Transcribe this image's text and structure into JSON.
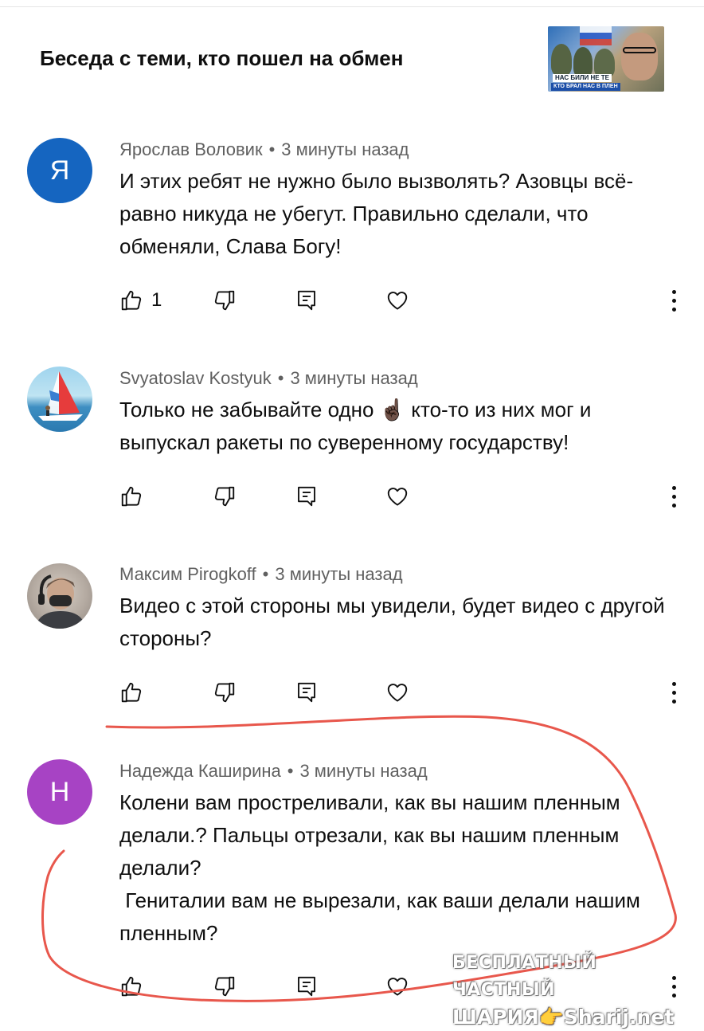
{
  "header": {
    "title": "Беседа с теми, кто пошел на обмен",
    "thumbnail_caption_1": "НАС БИЛИ НЕ ТЕ",
    "thumbnail_caption_2": "КТО БРАЛ НАС В ПЛЕН"
  },
  "comments": [
    {
      "author": "Ярослав Воловик",
      "time": "3 минуты назад",
      "avatar_letter": "Я",
      "avatar_color": "#1565c0",
      "text": "И этих ребят не нужно было вызволять? Азовцы всё-равно никуда не убегут. Правильно сделали, что обменяли, Слава Богу!",
      "likes": "1"
    },
    {
      "author": "Svyatoslav Kostyuk",
      "time": "3 минуты назад",
      "avatar_letter": "",
      "avatar_color": "#7fc1e0",
      "text": "Только не забывайте одно ☝🏿 кто-то из них мог и выпускал ракеты по суверенному государству!",
      "likes": ""
    },
    {
      "author": "Максим Pirogkoff",
      "time": "3 минуты назад",
      "avatar_letter": "",
      "avatar_color": "#b9b3ad",
      "text": "Видео с этой стороны мы увидели, будет видео с другой стороны?",
      "likes": ""
    },
    {
      "author": "Надежда Каширина",
      "time": "3 минуты назад",
      "avatar_letter": "Н",
      "avatar_color": "#a743c4",
      "text": "Колени вам простреливали, как вы нашим пленным делали.? Пальцы отрезали, как вы нашим пленным делали?\n Гениталии вам не вырезали, как ваши делали нашим пленным?",
      "likes": ""
    }
  ],
  "meta_separator": "•",
  "watermark": {
    "line1": "БЕСПЛАТНЫЙ ЧАСТНЫЙ",
    "line2": "ШАРИЯ👉Sharij.net"
  },
  "colors": {
    "text_primary": "#0f0f0f",
    "text_secondary": "#606060",
    "annotation_red": "#e8574c"
  },
  "icons": [
    "like-icon",
    "dislike-icon",
    "reply-icon",
    "heart-icon",
    "more-vert-icon"
  ]
}
